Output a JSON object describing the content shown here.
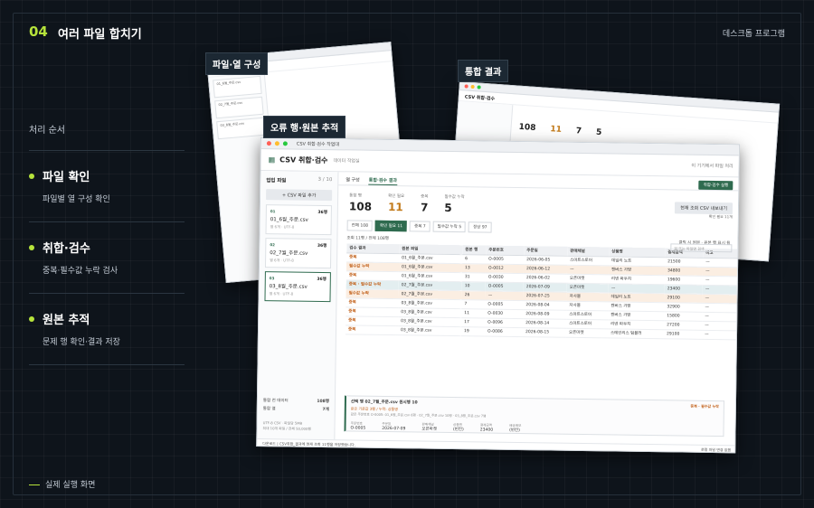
{
  "header": {
    "number": "04",
    "title": "여러 파일 합치기",
    "right": "데스크톱 프로그램"
  },
  "steps_label": "처리 순서",
  "steps": [
    {
      "title": "파일 확인",
      "desc": "파일별 열 구성 확인"
    },
    {
      "title": "취합·검수",
      "desc": "중복·필수값 누락 검사"
    },
    {
      "title": "원본 추적",
      "desc": "문제 행 확인·결과 저장"
    }
  ],
  "footer": "실제 실행 화면",
  "tags": {
    "a": "파일·열 구성",
    "b": "통합 결과",
    "c": "오류 행·원본 추적"
  },
  "colors": {
    "accent": "#b6e33b",
    "brand": "#2f6b4f",
    "issue": "#c2611a",
    "bg": "#0e141b"
  },
  "app": {
    "window_title": "CSV 취합·검수 작업대",
    "name": "CSV 취합·검수",
    "sub": "데이터 작업실",
    "right_note": "이 기기에서 파일 처리",
    "files_header": "업입 파일",
    "files_count": "3 / 10",
    "add_button": "+ CSV 파일 추가",
    "files": [
      {
        "num": "01",
        "name": "01_6월_주문.csv",
        "rows": "36행",
        "enc": "열 6개 · UTF-8"
      },
      {
        "num": "02",
        "name": "02_7월_주문.csv",
        "rows": "36행",
        "enc": "열 6개 · UTF-8"
      },
      {
        "num": "03",
        "name": "03_8월_주문.csv",
        "rows": "36행",
        "enc": "열 6개 · UTF-8"
      }
    ],
    "summary": [
      {
        "label": "통합 전 데이터",
        "value": "108행"
      },
      {
        "label": "통합 열",
        "value": "7개"
      }
    ],
    "summary_note": [
      "UTF-8 CSV · 파일당 5MB",
      "최대 10개 파일 / 전체 50,000행"
    ],
    "tabs": [
      "열 구성",
      "통합·검수 결과"
    ],
    "run_button": "취합·검수 실행",
    "stats": [
      {
        "label": "통합 행",
        "value": "108"
      },
      {
        "label": "확인 필요",
        "value": "11"
      },
      {
        "label": "중복",
        "value": "7"
      },
      {
        "label": "필수값 누락",
        "value": "5"
      }
    ],
    "export_button": "현재 조회 CSV 내보내기",
    "export_note": "확인 필요 11개",
    "chips": [
      "전체 108",
      "확인 필요 11",
      "중복 7",
      "필수값 누락 5",
      "정상 97"
    ],
    "search_placeholder": "검 또는 파일명 검색",
    "count_text": "조회 11행 / 전체 108행",
    "count_right": "클릭 시 원본 · 원본 행 표시 됨",
    "columns": [
      "검수 결과",
      "원본 파일",
      "원본 행",
      "주문번호",
      "주문일",
      "판매채널",
      "상품명",
      "결제금액",
      "비고"
    ],
    "rows": [
      [
        "중복",
        "01_6월_주문.csv",
        "6",
        "O-0005",
        "2026-06-05",
        "스마트스토어",
        "데일리 노트",
        "21500",
        "—"
      ],
      [
        "필수값 누락",
        "01_6월_주문.csv",
        "13",
        "O-0012",
        "2026-06-12",
        "—",
        "캔버스 가방",
        "34800",
        "—"
      ],
      [
        "중복",
        "01_6월_주문.csv",
        "31",
        "O-0030",
        "2026-06-02",
        "오픈마켓",
        "리넨 파우치",
        "19600",
        "—"
      ],
      [
        "중복 · 필수값 누락",
        "02_7월_주문.csv",
        "10",
        "O-0005",
        "2026-07-09",
        "오픈마켓",
        "—",
        "23400",
        "—"
      ],
      [
        "필수값 누락",
        "02_7월_주문.csv",
        "26",
        "—",
        "2026-07-25",
        "자사몰",
        "데일리 노트",
        "29100",
        "—"
      ],
      [
        "중복",
        "03_8월_주문.csv",
        "7",
        "O-0005",
        "2026-08-04",
        "자사몰",
        "캔버스 가방",
        "32900",
        "—"
      ],
      [
        "중복",
        "03_8월_주문.csv",
        "11",
        "O-0030",
        "2026-08-09",
        "스마트스토어",
        "캔버스 가방",
        "15800",
        "—"
      ],
      [
        "중복",
        "03_8월_주문.csv",
        "17",
        "O-0096",
        "2026-08-14",
        "스마트스토어",
        "리넨 파우치",
        "27200",
        "—"
      ],
      [
        "중복",
        "03_8월_주문.csv",
        "19",
        "O-0086",
        "2026-08-15",
        "오픈마켓",
        "스테인리스 텀블러",
        "29100",
        "—"
      ]
    ],
    "detail": {
      "title": "선택 행 02_7월_주문.csv 원시행 10",
      "tag": "중복 · 필수값 누락",
      "issue": "같은 기준값 3행 / 누락: 상품명",
      "source": "같은 주문번호 O-0005: 01_6월_주문.csv 6행 · 02_7월_주문.csv 10행 · 03_8월_주문.csv 7행",
      "fields": [
        {
          "k": "주문번호",
          "v": "O-0005"
        },
        {
          "k": "주문일",
          "v": "2026-07-09"
        },
        {
          "k": "판매채널",
          "v": "오픈마켓"
        },
        {
          "k": "상품명",
          "v": "(빈칸)"
        },
        {
          "k": "결제금액",
          "v": "23400"
        },
        {
          "k": "배송메모",
          "v": "(빈칸)"
        }
      ],
      "hint": "데이터는 중복 행과 선택 행의 원본 파일 열을 보여줍니다. 표의 각 행을 누르면 확인할 수 있습니다."
    },
    "status": "다운로드 | CSV취합_결과에 현재 조회 11행을 저장했습니다.",
    "status_right": "로컬 파일 변경 없음"
  }
}
